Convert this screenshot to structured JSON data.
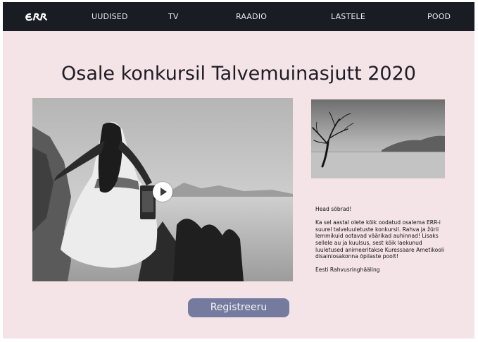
{
  "header": {
    "logo_text": "ERR",
    "nav": [
      {
        "label": "UUDISED"
      },
      {
        "label": "TV"
      },
      {
        "label": "RAADIO"
      },
      {
        "label": "LASTELE"
      },
      {
        "label": "POOD"
      }
    ]
  },
  "main": {
    "title": "Osale konkursil Talvemuinasjutt 2020",
    "video": {
      "play_icon": "play-icon"
    },
    "side_image": {
      "icon": "lone-tree-photo"
    },
    "text": {
      "greeting": "Head sõbrad!",
      "body": "Ka sel aastal olete kõik oodatud osalema ERR-i suurel talveluuletuste konkursil. Rahva ja žürii lemmikuid ootavad väärikad auhinnad! Lisaks sellele au ja kuulsus, sest kõik laekunud luuletused animeeritakse Kuressaare Ametikooli disainiosakonna õpilaste poolt!",
      "signature": "Eesti Rahvusringhääling"
    },
    "register_button": "Registreeru"
  },
  "colors": {
    "navbar_bg": "#1a1c24",
    "page_bg": "#f4e3e7",
    "button_bg": "#747b9e"
  }
}
